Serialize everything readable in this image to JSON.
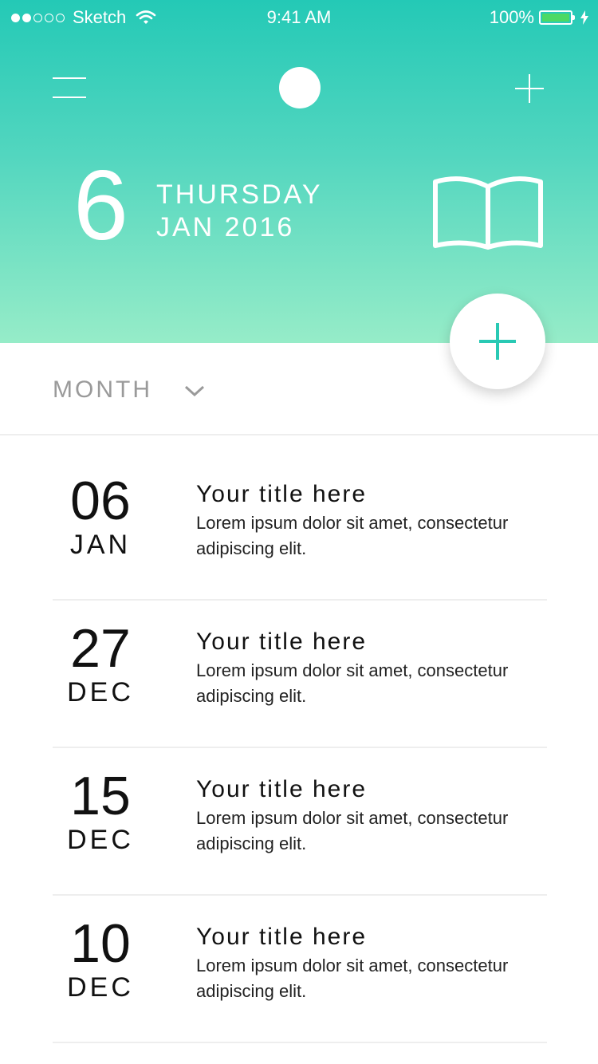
{
  "status_bar": {
    "carrier": "Sketch",
    "time": "9:41 AM",
    "battery": "100%"
  },
  "header": {
    "day": "6",
    "weekday": "THURSDAY",
    "month_year": "JAN 2016"
  },
  "filter": {
    "label": "MONTH"
  },
  "entries": [
    {
      "day": "06",
      "month": "JAN",
      "title": "Your title here",
      "body": "Lorem ipsum dolor sit amet, consectetur adipiscing elit."
    },
    {
      "day": "27",
      "month": "DEC",
      "title": "Your title here",
      "body": "Lorem ipsum dolor sit amet, consectetur adipiscing elit."
    },
    {
      "day": "15",
      "month": "DEC",
      "title": "Your title here",
      "body": "Lorem ipsum dolor sit amet, consectetur adipiscing elit."
    },
    {
      "day": "10",
      "month": "DEC",
      "title": "Your title here",
      "body": "Lorem ipsum dolor sit amet, consectetur adipiscing elit."
    }
  ],
  "colors": {
    "accent": "#29c9b4",
    "gradient_top": "#24c9b6",
    "gradient_bottom": "#96ecc8",
    "battery_fill": "#4cd964"
  },
  "icons": {
    "menu": "hamburger-icon",
    "avatar": "avatar",
    "add": "plus-icon",
    "journal": "open-book-icon",
    "dropdown": "chevron-down-icon",
    "wifi": "wifi-icon",
    "charging": "bolt-icon"
  }
}
